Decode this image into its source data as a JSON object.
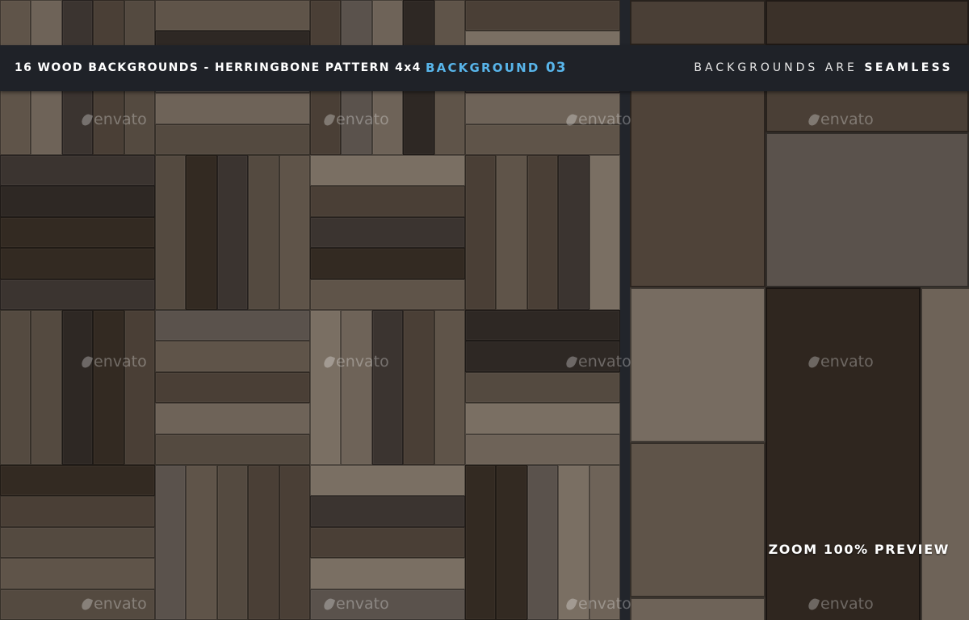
{
  "header": {
    "left_title": "16 WOOD BACKGROUNDS - HERRINGBONE PATTERN 4x4",
    "center_label": "BACKGROUND",
    "center_number": "03",
    "right_prefix": "BACKGROUNDS ARE",
    "right_emphasis": "SEAMLESS"
  },
  "watermark": {
    "text": "envato",
    "icon": "envato-leaf-icon"
  },
  "zoom_label": "ZOOM 100% PREVIEW",
  "colors": {
    "accent": "#58b5ea",
    "header_bg": "#1f2228",
    "wood_tones": [
      "#2e2824",
      "#3b3430",
      "#4a3f36",
      "#544a40",
      "#5f5449",
      "#6e6358",
      "#7a6f63",
      "#5a524c",
      "#332a22"
    ]
  }
}
